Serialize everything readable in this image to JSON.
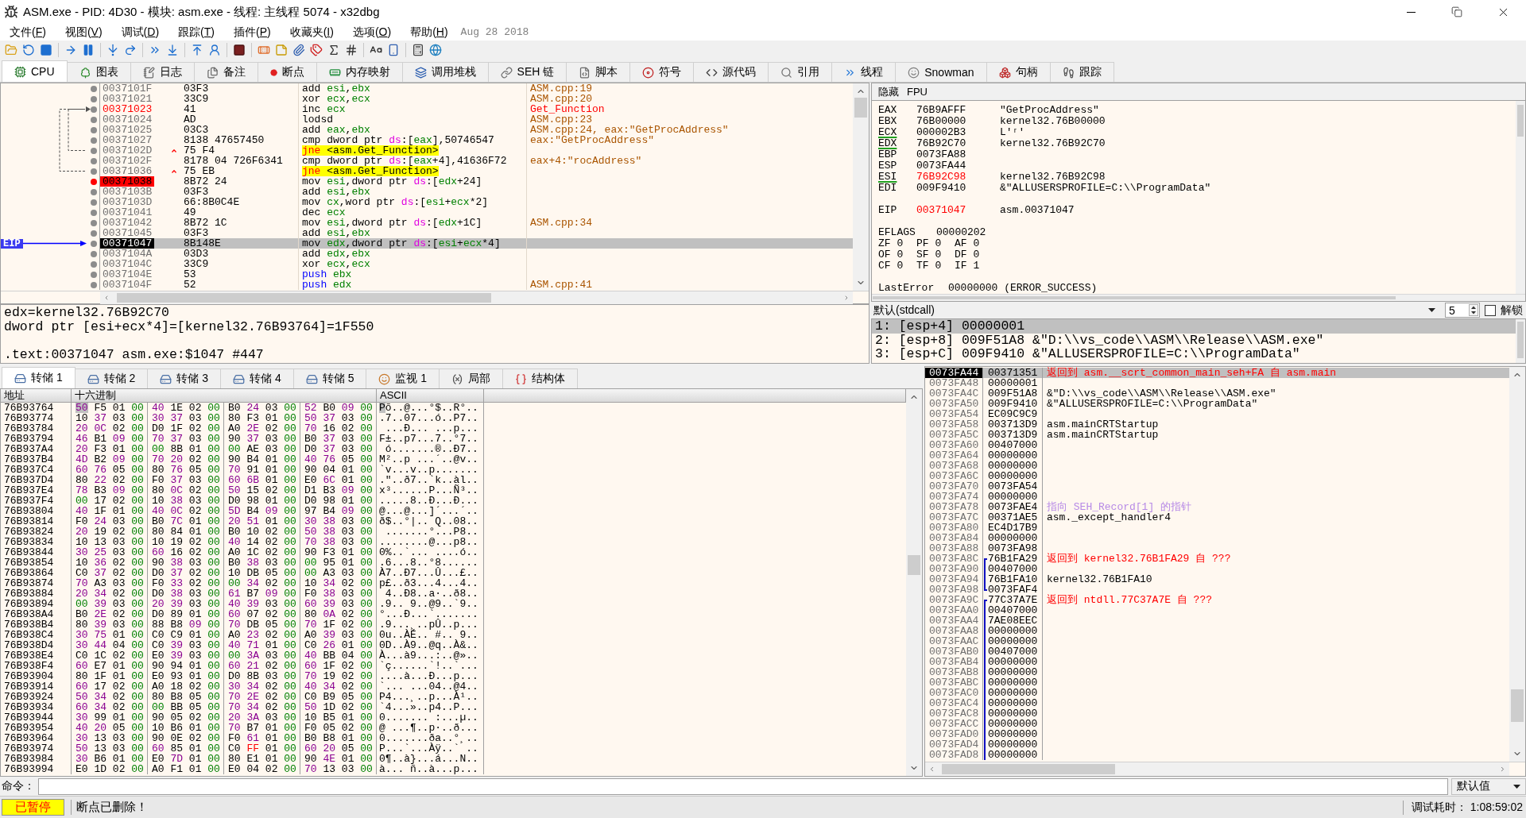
{
  "window": {
    "title": "ASM.exe - PID: 4D30 - 模块: asm.exe - 线程: 主线程 5074 - x32dbg"
  },
  "menu": {
    "items": [
      "文件(F)",
      "视图(V)",
      "调试(D)",
      "跟踪(T)",
      "插件(P)",
      "收藏夹(I)",
      "选项(O)",
      "帮助(H)"
    ],
    "build_date": "Aug 28 2018"
  },
  "tabs": [
    {
      "label": "CPU",
      "selected": true
    },
    {
      "label": "图表",
      "selected": false
    },
    {
      "label": "日志",
      "selected": false
    },
    {
      "label": "备注",
      "selected": false
    },
    {
      "label": "断点",
      "selected": false
    },
    {
      "label": "内存映射",
      "selected": false
    },
    {
      "label": "调用堆栈",
      "selected": false
    },
    {
      "label": "SEH 链",
      "selected": false
    },
    {
      "label": "脚本",
      "selected": false
    },
    {
      "label": "符号",
      "selected": false
    },
    {
      "label": "源代码",
      "selected": false
    },
    {
      "label": "引用",
      "selected": false
    },
    {
      "label": "线程",
      "selected": false
    },
    {
      "label": "Snowman",
      "selected": false
    },
    {
      "label": "句柄",
      "selected": false
    },
    {
      "label": "跟踪",
      "selected": false
    }
  ],
  "disassembly": {
    "eip_marker": "EIP",
    "rows": [
      {
        "address": "0037101F",
        "bytes": "03F3",
        "mnemonic": {
          "text": "add",
          "kind": "normal"
        },
        "operands": [
          {
            "text": "esi",
            "kind": "register"
          },
          {
            "text": ",",
            "kind": "plain"
          },
          {
            "text": "ebx",
            "kind": "register"
          }
        ],
        "comment": {
          "text": "ASM.cpp:19",
          "kind": "auto"
        },
        "breakpoint": false,
        "eip": false,
        "selected": false,
        "labeled": false,
        "jump_back": false,
        "jump_target": false
      },
      {
        "address": "00371021",
        "bytes": "33C9",
        "mnemonic": {
          "text": "xor",
          "kind": "normal"
        },
        "operands": [
          {
            "text": "ecx",
            "kind": "register"
          },
          {
            "text": ",",
            "kind": "plain"
          },
          {
            "text": "ecx",
            "kind": "register"
          }
        ],
        "comment": {
          "text": "ASM.cpp:20",
          "kind": "auto"
        },
        "breakpoint": false,
        "eip": false,
        "selected": false,
        "labeled": false,
        "jump_back": false,
        "jump_target": false
      },
      {
        "address": "00371023",
        "bytes": "41",
        "mnemonic": {
          "text": "inc",
          "kind": "normal"
        },
        "operands": [
          {
            "text": "ecx",
            "kind": "register"
          }
        ],
        "comment": {
          "text": "Get_Function",
          "kind": "label"
        },
        "breakpoint": false,
        "eip": false,
        "selected": false,
        "labeled": true,
        "jump_back": false,
        "jump_target": true
      },
      {
        "address": "00371024",
        "bytes": "AD",
        "mnemonic": {
          "text": "lodsd",
          "kind": "normal"
        },
        "comment": {
          "text": "ASM.cpp:23",
          "kind": "auto"
        },
        "breakpoint": false,
        "eip": false,
        "selected": false,
        "labeled": false,
        "jump_back": false,
        "jump_target": false
      },
      {
        "address": "00371025",
        "bytes": "03C3",
        "mnemonic": {
          "text": "add",
          "kind": "normal"
        },
        "operands": [
          {
            "text": "eax",
            "kind": "register"
          },
          {
            "text": ",",
            "kind": "plain"
          },
          {
            "text": "ebx",
            "kind": "register"
          }
        ],
        "comment": {
          "text": "ASM.cpp:24, eax:\"GetProcAddress\"",
          "kind": "auto"
        },
        "breakpoint": false,
        "eip": false,
        "selected": false,
        "labeled": false,
        "jump_back": false,
        "jump_target": false
      },
      {
        "address": "00371027",
        "bytes": "8138 47657450",
        "mnemonic": {
          "text": "cmp",
          "kind": "normal"
        },
        "operands": [
          {
            "text": "dword ptr ",
            "kind": "plain"
          },
          {
            "text": "ds",
            "kind": "segment"
          },
          {
            "text": ":[",
            "kind": "plain"
          },
          {
            "text": "eax",
            "kind": "register"
          },
          {
            "text": "],50746547",
            "kind": "plain"
          }
        ],
        "comment": {
          "text": "eax:\"GetProcAddress\"",
          "kind": "auto"
        },
        "breakpoint": false,
        "eip": false,
        "selected": false,
        "labeled": false,
        "jump_back": false,
        "jump_target": false
      },
      {
        "address": "0037102D",
        "bytes": "75 F4",
        "mnemonic": {
          "text": "jne",
          "kind": "jump"
        },
        "operands": [
          {
            "text": "<asm.Get_Function>",
            "kind": "plain"
          }
        ],
        "breakpoint": false,
        "eip": false,
        "selected": false,
        "labeled": false,
        "jump_back": true,
        "jump_target": false
      },
      {
        "address": "0037102F",
        "bytes": "8178 04 726F6341",
        "mnemonic": {
          "text": "cmp",
          "kind": "normal"
        },
        "operands": [
          {
            "text": "dword ptr ",
            "kind": "plain"
          },
          {
            "text": "ds",
            "kind": "segment"
          },
          {
            "text": ":[",
            "kind": "plain"
          },
          {
            "text": "eax",
            "kind": "register"
          },
          {
            "text": "+4],41636F72",
            "kind": "plain"
          }
        ],
        "comment": {
          "text": "eax+4:\"rocAddress\"",
          "kind": "auto"
        },
        "breakpoint": false,
        "eip": false,
        "selected": false,
        "labeled": false,
        "jump_back": false,
        "jump_target": false
      },
      {
        "address": "00371036",
        "bytes": "75 EB",
        "mnemonic": {
          "text": "jne",
          "kind": "jump"
        },
        "operands": [
          {
            "text": "<asm.Get_Function>",
            "kind": "plain"
          }
        ],
        "breakpoint": false,
        "eip": false,
        "selected": false,
        "labeled": false,
        "jump_back": true,
        "jump_target": false
      },
      {
        "address": "00371038",
        "bytes": "8B72 24",
        "mnemonic": {
          "text": "mov",
          "kind": "normal"
        },
        "operands": [
          {
            "text": "esi",
            "kind": "register"
          },
          {
            "text": ",dword ptr ",
            "kind": "plain"
          },
          {
            "text": "ds",
            "kind": "segment"
          },
          {
            "text": ":[",
            "kind": "plain"
          },
          {
            "text": "edx",
            "kind": "register"
          },
          {
            "text": "+24]",
            "kind": "plain"
          }
        ],
        "breakpoint": true,
        "eip": false,
        "selected": false,
        "labeled": false,
        "jump_back": false,
        "jump_target": false
      },
      {
        "address": "0037103B",
        "bytes": "03F3",
        "mnemonic": {
          "text": "add",
          "kind": "normal"
        },
        "operands": [
          {
            "text": "esi",
            "kind": "register"
          },
          {
            "text": ",",
            "kind": "plain"
          },
          {
            "text": "ebx",
            "kind": "register"
          }
        ],
        "breakpoint": false,
        "eip": false,
        "selected": false,
        "labeled": false,
        "jump_back": false,
        "jump_target": false
      },
      {
        "address": "0037103D",
        "bytes": "66:8B0C4E",
        "mnemonic": {
          "text": "mov",
          "kind": "normal"
        },
        "operands": [
          {
            "text": "cx",
            "kind": "register"
          },
          {
            "text": ",word ptr ",
            "kind": "plain"
          },
          {
            "text": "ds",
            "kind": "segment"
          },
          {
            "text": ":[",
            "kind": "plain"
          },
          {
            "text": "esi",
            "kind": "register"
          },
          {
            "text": "+",
            "kind": "plain"
          },
          {
            "text": "ecx",
            "kind": "register"
          },
          {
            "text": "*2]",
            "kind": "plain"
          }
        ],
        "breakpoint": false,
        "eip": false,
        "selected": false,
        "labeled": false,
        "jump_back": false,
        "jump_target": false
      },
      {
        "address": "00371041",
        "bytes": "49",
        "mnemonic": {
          "text": "dec",
          "kind": "normal"
        },
        "operands": [
          {
            "text": "ecx",
            "kind": "register"
          }
        ],
        "breakpoint": false,
        "eip": false,
        "selected": false,
        "labeled": false,
        "jump_back": false,
        "jump_target": false
      },
      {
        "address": "00371042",
        "bytes": "8B72 1C",
        "mnemonic": {
          "text": "mov",
          "kind": "normal"
        },
        "operands": [
          {
            "text": "esi",
            "kind": "register"
          },
          {
            "text": ",dword ptr ",
            "kind": "plain"
          },
          {
            "text": "ds",
            "kind": "segment"
          },
          {
            "text": ":[",
            "kind": "plain"
          },
          {
            "text": "edx",
            "kind": "register"
          },
          {
            "text": "+1C]",
            "kind": "plain"
          }
        ],
        "comment": {
          "text": "ASM.cpp:34",
          "kind": "auto"
        },
        "breakpoint": false,
        "eip": false,
        "selected": false,
        "labeled": false,
        "jump_back": false,
        "jump_target": false
      },
      {
        "address": "00371045",
        "bytes": "03F3",
        "mnemonic": {
          "text": "add",
          "kind": "normal"
        },
        "operands": [
          {
            "text": "esi",
            "kind": "register"
          },
          {
            "text": ",",
            "kind": "plain"
          },
          {
            "text": "ebx",
            "kind": "register"
          }
        ],
        "breakpoint": false,
        "eip": false,
        "selected": false,
        "labeled": false,
        "jump_back": false,
        "jump_target": false
      },
      {
        "address": "00371047",
        "bytes": "8B148E",
        "mnemonic": {
          "text": "mov",
          "kind": "normal"
        },
        "operands": [
          {
            "text": "edx",
            "kind": "register"
          },
          {
            "text": ",dword ptr ",
            "kind": "plain"
          },
          {
            "text": "ds",
            "kind": "segment"
          },
          {
            "text": ":[",
            "kind": "plain"
          },
          {
            "text": "esi",
            "kind": "register"
          },
          {
            "text": "+",
            "kind": "plain"
          },
          {
            "text": "ecx",
            "kind": "register"
          },
          {
            "text": "*4]",
            "kind": "plain"
          }
        ],
        "breakpoint": false,
        "eip": true,
        "selected": true,
        "labeled": false,
        "jump_back": false,
        "jump_target": false
      },
      {
        "address": "0037104A",
        "bytes": "03D3",
        "mnemonic": {
          "text": "add",
          "kind": "normal"
        },
        "operands": [
          {
            "text": "edx",
            "kind": "register"
          },
          {
            "text": ",",
            "kind": "plain"
          },
          {
            "text": "ebx",
            "kind": "register"
          }
        ],
        "breakpoint": false,
        "eip": false,
        "selected": false,
        "labeled": false,
        "jump_back": false,
        "jump_target": false
      },
      {
        "address": "0037104C",
        "bytes": "33C9",
        "mnemonic": {
          "text": "xor",
          "kind": "normal"
        },
        "operands": [
          {
            "text": "ecx",
            "kind": "register"
          },
          {
            "text": ",",
            "kind": "plain"
          },
          {
            "text": "ecx",
            "kind": "register"
          }
        ],
        "breakpoint": false,
        "eip": false,
        "selected": false,
        "labeled": false,
        "jump_back": false,
        "jump_target": false
      },
      {
        "address": "0037104E",
        "bytes": "53",
        "mnemonic": {
          "text": "push",
          "kind": "stack"
        },
        "operands": [
          {
            "text": "ebx",
            "kind": "register"
          }
        ],
        "breakpoint": false,
        "eip": false,
        "selected": false,
        "labeled": false,
        "jump_back": false,
        "jump_target": false
      },
      {
        "address": "0037104F",
        "bytes": "52",
        "mnemonic": {
          "text": "push",
          "kind": "stack"
        },
        "operands": [
          {
            "text": "edx",
            "kind": "register"
          }
        ],
        "comment": {
          "text": "ASM.cpp:41",
          "kind": "auto"
        },
        "breakpoint": false,
        "eip": false,
        "selected": false,
        "labeled": false,
        "jump_back": false,
        "jump_target": false
      }
    ]
  },
  "info": {
    "lines": [
      "edx=kernel32.76B92C70",
      "dword ptr [esi+ecx*4]=[kernel32.76B93764]=1F550"
    ],
    "location": ".text:00371047 asm.exe:$1047 #447"
  },
  "registers": {
    "hide_button": "隐藏",
    "fpu_button": "FPU",
    "general": [
      {
        "name": "EAX",
        "value": "76B9AFFF",
        "comment": "\"GetProcAddress\"",
        "changed": false,
        "underlined": false
      },
      {
        "name": "EBX",
        "value": "76B00000",
        "comment": "kernel32.76B00000",
        "changed": false,
        "underlined": false
      },
      {
        "name": "ECX",
        "value": "000002B3",
        "comment": "L'ʳ'",
        "changed": false,
        "underlined": true
      },
      {
        "name": "EDX",
        "value": "76B92C70",
        "comment": "kernel32.76B92C70",
        "changed": false,
        "underlined": true
      },
      {
        "name": "EBP",
        "value": "0073FA88",
        "changed": false,
        "underlined": false
      },
      {
        "name": "ESP",
        "value": "0073FA44",
        "changed": false,
        "underlined": false
      },
      {
        "name": "ESI",
        "value": "76B92C98",
        "comment": "kernel32.76B92C98",
        "changed": true,
        "underlined": true
      },
      {
        "name": "EDI",
        "value": "009F9410",
        "comment": "&\"ALLUSERSPROFILE=C:\\\\ProgramData\"",
        "changed": false,
        "underlined": false
      }
    ],
    "eip": {
      "name": "EIP",
      "value": "00371047",
      "comment": "asm.00371047",
      "changed": true,
      "underlined": false
    },
    "eflags": {
      "name": "EFLAGS",
      "value": "00000202"
    },
    "flags": [
      {
        "name": "ZF",
        "value": "0"
      },
      {
        "name": "PF",
        "value": "0"
      },
      {
        "name": "AF",
        "value": "0"
      },
      {
        "name": "OF",
        "value": "0"
      },
      {
        "name": "SF",
        "value": "0"
      },
      {
        "name": "DF",
        "value": "0"
      },
      {
        "name": "CF",
        "value": "0"
      },
      {
        "name": "TF",
        "value": "0"
      },
      {
        "name": "IF",
        "value": "1"
      }
    ],
    "last_error": {
      "name": "LastError",
      "value": "00000000 (ERROR_SUCCESS)"
    }
  },
  "call_arguments": {
    "convention": "默认(stdcall)",
    "count": "5",
    "unlock": {
      "label": "解锁",
      "checked": false
    },
    "args": [
      {
        "text": "1: [esp+4] 00000001",
        "selected": true
      },
      {
        "text": "2: [esp+8] 009F51A8 &\"D:\\\\vs_code\\\\ASM\\\\Release\\\\ASM.exe\"",
        "selected": false
      },
      {
        "text": "3: [esp+C] 009F9410 &\"ALLUSERSPROFILE=C:\\\\ProgramData\"",
        "selected": false
      }
    ]
  },
  "dump_tabs": [
    {
      "label": "转储 1",
      "kind": "dump",
      "selected": true
    },
    {
      "label": "转储 2",
      "kind": "dump",
      "selected": false
    },
    {
      "label": "转储 3",
      "kind": "dump",
      "selected": false
    },
    {
      "label": "转储 4",
      "kind": "dump",
      "selected": false
    },
    {
      "label": "转储 5",
      "kind": "dump",
      "selected": false
    },
    {
      "label": "监视 1",
      "kind": "watch",
      "selected": false
    },
    {
      "label": "局部",
      "kind": "locals",
      "selected": false
    },
    {
      "label": "结构体",
      "kind": "struct",
      "selected": false
    }
  ],
  "dump": {
    "columns": [
      "地址",
      "十六进制",
      "ASCII"
    ],
    "rows": [
      {
        "address": "76B93764",
        "hex": [
          "50 F5 01 00",
          "40 1E 02 00",
          "B0 24 03 00",
          "52 B0 09 00"
        ],
        "ascii": "Põ..@...°$..R°..",
        "selected": true
      },
      {
        "address": "76B93774",
        "hex": [
          "10 37 03 00",
          "30 37 03 00",
          "80 F3 01 00",
          "50 37 03 00"
        ],
        "ascii": ".7..07...ó..P7..",
        "selected": false
      },
      {
        "address": "76B93784",
        "hex": [
          "20 0C 02 00",
          "D0 1F 02 00",
          "A0 2E 02 00",
          "70 16 02 00"
        ],
        "ascii": " ...Ð... ...p...",
        "selected": false
      },
      {
        "address": "76B93794",
        "hex": [
          "46 B1 09 00",
          "70 37 03 00",
          "90 37 03 00",
          "B0 37 03 00"
        ],
        "ascii": "F±..p7...7..°7..",
        "selected": false
      },
      {
        "address": "76B937A4",
        "hex": [
          "20 F3 01 00",
          "00 8B 01 00",
          "00 AE 03 00",
          "D0 37 03 00"
        ],
        "ascii": " ó.......®..Ð7..",
        "selected": false
      },
      {
        "address": "76B937B4",
        "hex": [
          "4D B2 09 00",
          "70 20 02 00",
          "90 B4 01 00",
          "40 76 05 00"
        ],
        "ascii": "M²..p ...´..@v..",
        "selected": false
      },
      {
        "address": "76B937C4",
        "hex": [
          "60 76 05 00",
          "80 76 05 00",
          "70 91 01 00",
          "90 04 01 00"
        ],
        "ascii": "`v...v..p.......",
        "selected": false
      },
      {
        "address": "76B937D4",
        "hex": [
          "80 22 02 00",
          "F0 37 03 00",
          "60 6B 01 00",
          "E0 6C 01 00"
        ],
        "ascii": ".\"..ð7..`k..àl..",
        "selected": false
      },
      {
        "address": "76B937E4",
        "hex": [
          "78 B3 09 00",
          "80 0C 02 00",
          "50 15 02 00",
          "D1 B3 09 00"
        ],
        "ascii": "x³......P...Ñ³..",
        "selected": false
      },
      {
        "address": "76B937F4",
        "hex": [
          "00 17 02 00",
          "10 38 03 00",
          "D0 98 01 00",
          "D0 98 01 00"
        ],
        "ascii": ".....8..Ð...Ð...",
        "selected": false
      },
      {
        "address": "76B93804",
        "hex": [
          "40 1F 01 00",
          "40 0C 02 00",
          "5D B4 09 00",
          "97 B4 09 00"
        ],
        "ascii": "@...@...]´...´..",
        "selected": false
      },
      {
        "address": "76B93814",
        "hex": [
          "F0 24 03 00",
          "B0 7C 01 00",
          "20 51 01 00",
          "30 38 03 00"
        ],
        "ascii": "ð$..°|.. Q..08..",
        "selected": false
      },
      {
        "address": "76B93824",
        "hex": [
          "20 19 02 00",
          "80 84 01 00",
          "B0 10 02 00",
          "50 38 03 00"
        ],
        "ascii": " .......°...P8..",
        "selected": false
      },
      {
        "address": "76B93834",
        "hex": [
          "10 13 03 00",
          "10 19 02 00",
          "40 14 02 00",
          "70 38 03 00"
        ],
        "ascii": "........@...p8..",
        "selected": false
      },
      {
        "address": "76B93844",
        "hex": [
          "30 25 03 00",
          "60 16 02 00",
          "A0 1C 02 00",
          "90 F3 01 00"
        ],
        "ascii": "0%..`... ....ó..",
        "selected": false
      },
      {
        "address": "76B93854",
        "hex": [
          "10 36 02 00",
          "90 38 03 00",
          "B0 38 03 00",
          "00 95 01 00"
        ],
        "ascii": ".6...8..°8......",
        "selected": false
      },
      {
        "address": "76B93864",
        "hex": [
          "C0 37 02 00",
          "D0 37 02 00",
          "10 DB 05 00",
          "00 A3 03 00"
        ],
        "ascii": "À7..Ð7...Û...£..",
        "selected": false
      },
      {
        "address": "76B93874",
        "hex": [
          "70 A3 03 00",
          "F0 33 02 00",
          "00 34 02 00",
          "10 34 02 00"
        ],
        "ascii": "p£..ð3...4...4..",
        "selected": false
      },
      {
        "address": "76B93884",
        "hex": [
          "20 34 02 00",
          "D0 38 03 00",
          "61 B7 09 00",
          "F0 38 03 00"
        ],
        "ascii": " 4..Ð8..a·..ð8..",
        "selected": false
      },
      {
        "address": "76B93894",
        "hex": [
          "00 39 03 00",
          "20 39 03 00",
          "40 39 03 00",
          "60 39 03 00"
        ],
        "ascii": ".9.. 9..@9..`9..",
        "selected": false
      },
      {
        "address": "76B938A4",
        "hex": [
          "B0 2E 02 00",
          "D0 89 01 00",
          "60 07 02 00",
          "80 0A 02 00"
        ],
        "ascii": "°...Ð...`.......",
        "selected": false
      },
      {
        "address": "76B938B4",
        "hex": [
          "80 39 03 00",
          "88 B8 09 00",
          "70 DB 05 00",
          "70 1F 02 00"
        ],
        "ascii": ".9...¸..pÛ..p...",
        "selected": false
      },
      {
        "address": "76B938C4",
        "hex": [
          "30 75 01 00",
          "C0 C9 01 00",
          "A0 23 02 00",
          "A0 39 03 00"
        ],
        "ascii": "0u..ÀÉ.. #.. 9..",
        "selected": false
      },
      {
        "address": "76B938D4",
        "hex": [
          "30 44 04 00",
          "C0 39 03 00",
          "40 71 01 00",
          "C0 26 01 00"
        ],
        "ascii": "0D..À9..@q..À&..",
        "selected": false
      },
      {
        "address": "76B938E4",
        "hex": [
          "C0 1C 02 00",
          "E0 39 03 00",
          "00 3A 03 00",
          "40 BB 04 00"
        ],
        "ascii": "À...à9...:..@»..",
        "selected": false
      },
      {
        "address": "76B938F4",
        "hex": [
          "60 E7 01 00",
          "90 94 01 00",
          "60 21 02 00",
          "60 1F 02 00"
        ],
        "ascii": "`ç......`!..`...",
        "selected": false
      },
      {
        "address": "76B93904",
        "hex": [
          "80 1F 01 00",
          "E0 93 01 00",
          "D0 8B 03 00",
          "70 19 02 00"
        ],
        "ascii": "....à...Ð...p...",
        "selected": false
      },
      {
        "address": "76B93914",
        "hex": [
          "60 17 02 00",
          "A0 18 02 00",
          "30 34 02 00",
          "40 34 02 00"
        ],
        "ascii": "`... ...04..@4..",
        "selected": false
      },
      {
        "address": "76B93924",
        "hex": [
          "50 34 02 00",
          "80 B8 05 00",
          "70 2E 02 00",
          "C0 B9 05 00"
        ],
        "ascii": "P4...¸..p...À¹..",
        "selected": false
      },
      {
        "address": "76B93934",
        "hex": [
          "60 34 02 00",
          "00 BB 05 00",
          "70 34 02 00",
          "50 1D 02 00"
        ],
        "ascii": "`4...»..p4..P...",
        "selected": false
      },
      {
        "address": "76B93944",
        "hex": [
          "30 99 01 00",
          "90 05 02 00",
          "20 3A 03 00",
          "10 B5 01 00"
        ],
        "ascii": "0....... :...µ..",
        "selected": false
      },
      {
        "address": "76B93954",
        "hex": [
          "40 20 05 00",
          "10 B6 01 00",
          "70 B7 01 00",
          "F0 05 02 00"
        ],
        "ascii": "@ ...¶..p·..ð...",
        "selected": false
      },
      {
        "address": "76B93964",
        "hex": [
          "30 13 03 00",
          "90 0E 02 00",
          "F0 61 01 00",
          "B0 B8 01 00"
        ],
        "ascii": "0.......ða..°¸..",
        "selected": false
      },
      {
        "address": "76B93974",
        "hex": [
          "50 13 03 00",
          "60 85 01 00",
          "C0 FF 01 00",
          "60 20 05 00"
        ],
        "ascii": "P...`...Àÿ..` ..",
        "selected": false
      },
      {
        "address": "76B93984",
        "hex": [
          "30 B6 01 00",
          "E0 7D 01 00",
          "80 E1 01 00",
          "90 4E 01 00"
        ],
        "ascii": "0¶..à}...á...N..",
        "selected": false
      },
      {
        "address": "76B93994",
        "hex": [
          "E0 1D 02 00",
          "A0 F1 01 00",
          "E0 04 02 00",
          "70 13 03 00"
        ],
        "ascii": "à... ñ..à...p...",
        "selected": false
      }
    ]
  },
  "stack": {
    "rows": [
      {
        "address": "0073FA44",
        "value": "00371351",
        "comment": {
          "text": "返回到 asm.__scrt_common_main_seh+FA 自 asm.main",
          "kind": "return"
        },
        "selected": true
      },
      {
        "address": "0073FA48",
        "value": "00000001",
        "selected": false
      },
      {
        "address": "0073FA4C",
        "value": "009F51A8",
        "comment": {
          "text": "&\"D:\\\\vs_code\\\\ASM\\\\Release\\\\ASM.exe\"",
          "kind": "plain"
        },
        "selected": false
      },
      {
        "address": "0073FA50",
        "value": "009F9410",
        "comment": {
          "text": "&\"ALLUSERSPROFILE=C:\\\\ProgramData\"",
          "kind": "plain"
        },
        "selected": false
      },
      {
        "address": "0073FA54",
        "value": "EC09C9C9",
        "selected": false
      },
      {
        "address": "0073FA58",
        "value": "003713D9",
        "comment": {
          "text": "asm.mainCRTStartup",
          "kind": "plain"
        },
        "selected": false
      },
      {
        "address": "0073FA5C",
        "value": "003713D9",
        "comment": {
          "text": "asm.mainCRTStartup",
          "kind": "plain"
        },
        "selected": false
      },
      {
        "address": "0073FA60",
        "value": "00407000",
        "selected": false
      },
      {
        "address": "0073FA64",
        "value": "00000000",
        "selected": false
      },
      {
        "address": "0073FA68",
        "value": "00000000",
        "selected": false
      },
      {
        "address": "0073FA6C",
        "value": "00000000",
        "selected": false
      },
      {
        "address": "0073FA70",
        "value": "0073FA54",
        "selected": false
      },
      {
        "address": "0073FA74",
        "value": "00000000",
        "selected": false
      },
      {
        "address": "0073FA78",
        "value": "0073FAE4",
        "comment": {
          "text": "指向 SEH_Record[1] 的指针",
          "kind": "seh"
        },
        "selected": false
      },
      {
        "address": "0073FA7C",
        "value": "00371AE5",
        "comment": {
          "text": "asm._except_handler4",
          "kind": "plain"
        },
        "selected": false
      },
      {
        "address": "0073FA80",
        "value": "EC4D17B9",
        "selected": false
      },
      {
        "address": "0073FA84",
        "value": "00000000",
        "selected": false
      },
      {
        "address": "0073FA88",
        "value": "0073FA98",
        "selected": false
      },
      {
        "address": "0073FA8C",
        "value": "76B1FA29",
        "comment": {
          "text": "返回到 kernel32.76B1FA29 自 ???",
          "kind": "return"
        },
        "selected": false,
        "bracket": {
          "kind": "start"
        }
      },
      {
        "address": "0073FA90",
        "value": "00407000",
        "selected": false,
        "bracket": {
          "kind": "mid"
        }
      },
      {
        "address": "0073FA94",
        "value": "76B1FA10",
        "comment": {
          "text": "kernel32.76B1FA10",
          "kind": "plain"
        },
        "selected": false,
        "bracket": {
          "kind": "mid"
        }
      },
      {
        "address": "0073FA98",
        "value": "0073FAF4",
        "selected": false,
        "bracket": {
          "kind": "end"
        }
      },
      {
        "address": "0073FA9C",
        "value": "77C37A7E",
        "comment": {
          "text": "返回到 ntdll.77C37A7E 自 ???",
          "kind": "return"
        },
        "selected": false,
        "bracket": {
          "kind": "start"
        }
      },
      {
        "address": "0073FAA0",
        "value": "00407000",
        "selected": false,
        "bracket": {
          "kind": "mid"
        }
      },
      {
        "address": "0073FAA4",
        "value": "7AE08EEC",
        "selected": false,
        "bracket": {
          "kind": "mid"
        }
      },
      {
        "address": "0073FAA8",
        "value": "00000000",
        "selected": false,
        "bracket": {
          "kind": "mid"
        }
      },
      {
        "address": "0073FAAC",
        "value": "00000000",
        "selected": false,
        "bracket": {
          "kind": "mid"
        }
      },
      {
        "address": "0073FAB0",
        "value": "00407000",
        "selected": false,
        "bracket": {
          "kind": "mid"
        }
      },
      {
        "address": "0073FAB4",
        "value": "00000000",
        "selected": false,
        "bracket": {
          "kind": "mid"
        }
      },
      {
        "address": "0073FAB8",
        "value": "00000000",
        "selected": false,
        "bracket": {
          "kind": "mid"
        }
      },
      {
        "address": "0073FABC",
        "value": "00000000",
        "selected": false,
        "bracket": {
          "kind": "mid"
        }
      },
      {
        "address": "0073FAC0",
        "value": "00000000",
        "selected": false,
        "bracket": {
          "kind": "mid"
        }
      },
      {
        "address": "0073FAC4",
        "value": "00000000",
        "selected": false,
        "bracket": {
          "kind": "mid"
        }
      },
      {
        "address": "0073FAC8",
        "value": "00000000",
        "selected": false,
        "bracket": {
          "kind": "mid"
        }
      },
      {
        "address": "0073FACC",
        "value": "00000000",
        "selected": false,
        "bracket": {
          "kind": "mid"
        }
      },
      {
        "address": "0073FAD0",
        "value": "00000000",
        "selected": false,
        "bracket": {
          "kind": "mid"
        }
      },
      {
        "address": "0073FAD4",
        "value": "00000000",
        "selected": false,
        "bracket": {
          "kind": "mid"
        }
      },
      {
        "address": "0073FAD8",
        "value": "00000000",
        "selected": false,
        "bracket": {
          "kind": "mid"
        }
      }
    ]
  },
  "command": {
    "label": "命令：",
    "mode": "默认值"
  },
  "status_bar": {
    "state": "已暂停",
    "message": "断点已删除！",
    "timer": "调试耗时： 1:08:59:02"
  }
}
